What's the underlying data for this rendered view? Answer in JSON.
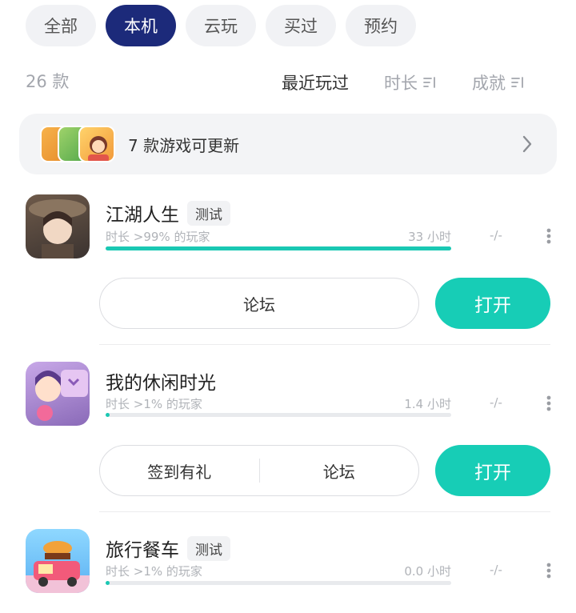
{
  "tabs": [
    {
      "label": "全部",
      "active": false
    },
    {
      "label": "本机",
      "active": true
    },
    {
      "label": "云玩",
      "active": false
    },
    {
      "label": "买过",
      "active": false
    },
    {
      "label": "预约",
      "active": false
    }
  ],
  "summary": {
    "count_label": "26 款",
    "sort": [
      {
        "label": "最近玩过",
        "active": true,
        "icon": null
      },
      {
        "label": "时长",
        "active": false,
        "icon": "sort-list-icon"
      },
      {
        "label": "成就",
        "active": false,
        "icon": "sort-list-icon"
      }
    ]
  },
  "update_banner": {
    "text": "7 款游戏可更新",
    "arrow_icon": "chevron-right-icon"
  },
  "games": [
    {
      "name": "江湖人生",
      "tag": "测试",
      "playtime_rank": "时长 >99% 的玩家",
      "playtime": "33 小时",
      "progress": 1.0,
      "rating": "-/-",
      "actions": [
        "论坛"
      ],
      "open_label": "打开"
    },
    {
      "name": "我的休闲时光",
      "tag": "",
      "playtime_rank": "时长 >1% 的玩家",
      "playtime": "1.4 小时",
      "progress": 0.01,
      "rating": "-/-",
      "actions": [
        "签到有礼",
        "论坛"
      ],
      "open_label": "打开"
    },
    {
      "name": "旅行餐车",
      "tag": "测试",
      "playtime_rank": "时长 >1% 的玩家",
      "playtime": "0.0 小时",
      "progress": 0.01,
      "rating": "-/-",
      "actions": [],
      "open_label": ""
    }
  ],
  "colors": {
    "accent": "#17cdb6",
    "active_tab": "#1c2a7a"
  }
}
